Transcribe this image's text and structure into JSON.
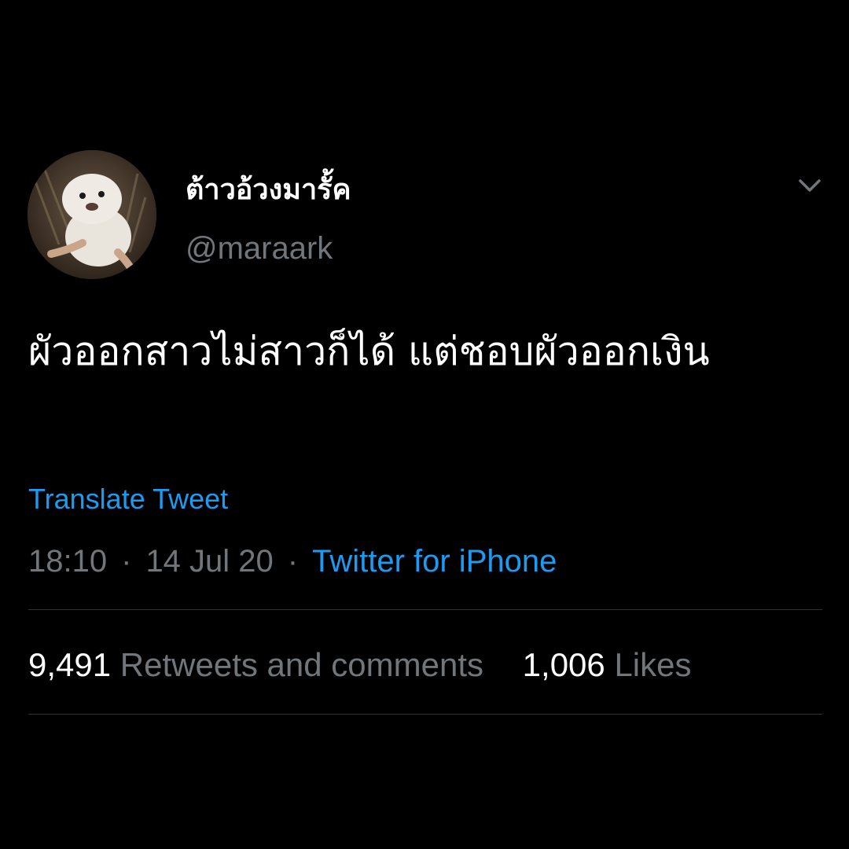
{
  "tweet": {
    "display_name": "ต้าวอ้วงมารั้ค",
    "handle": "@maraark",
    "text": "ผัวออกสาวไม่สาวก็ได้ แต่ชอบผัวออกเงิน",
    "translate_label": "Translate Tweet",
    "time": "18:10",
    "date": "14 Jul 20",
    "separator": "·",
    "source": "Twitter for iPhone",
    "avatar_icon": "seal-pup-avatar",
    "more_icon": "chevron-down-icon"
  },
  "stats": {
    "retweets_count": "9,491",
    "retweets_label": "Retweets and comments",
    "likes_count": "1,006",
    "likes_label": "Likes"
  },
  "colors": {
    "background": "#000000",
    "text": "#ffffff",
    "secondary": "#71767b",
    "accent": "#1d9bf0",
    "divider": "#2f3336"
  }
}
